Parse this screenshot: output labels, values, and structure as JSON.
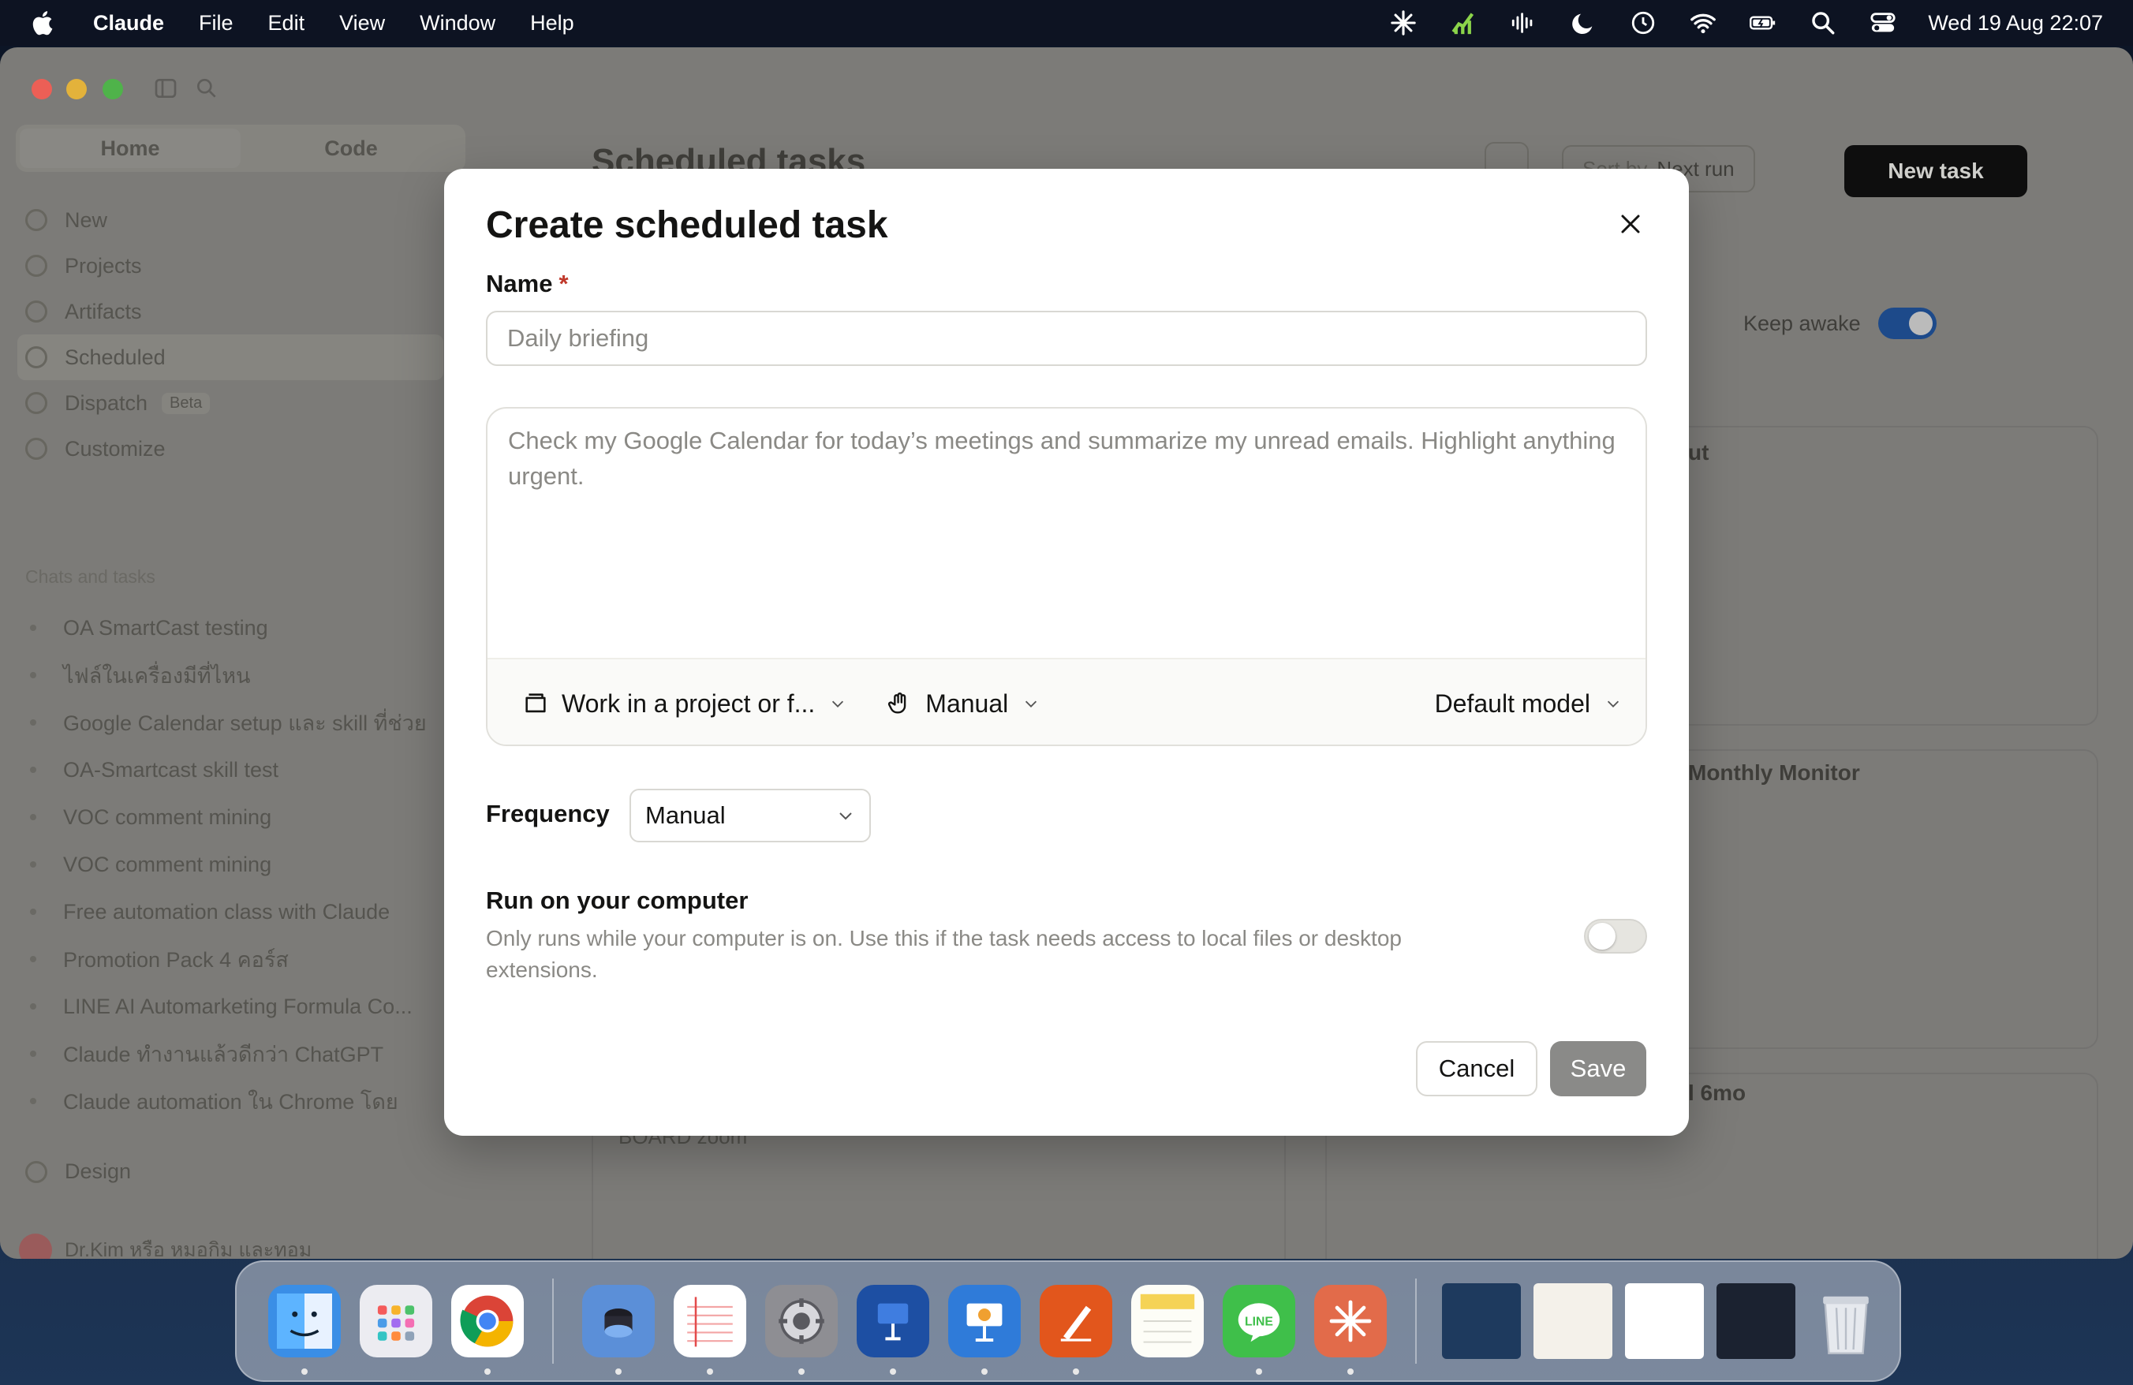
{
  "menubar": {
    "app_name": "Claude",
    "menus": [
      "File",
      "Edit",
      "View",
      "Window",
      "Help"
    ],
    "clock": "Wed 19 Aug  22:07",
    "status_icons": [
      "claude-icon",
      "stocks-icon",
      "audio-icon",
      "moon-icon",
      "timemachine-icon",
      "wifi-icon",
      "battery-icon",
      "search-icon",
      "control-center-icon"
    ]
  },
  "app": {
    "sidebar": {
      "modes": [
        "Home",
        "Code"
      ],
      "nav": [
        {
          "label": "New"
        },
        {
          "label": "Projects"
        },
        {
          "label": "Artifacts"
        },
        {
          "label": "Scheduled",
          "active": true
        },
        {
          "label": "Dispatch",
          "badge": "Beta"
        },
        {
          "label": "Customize"
        }
      ],
      "section_title": "Chats and tasks",
      "chats": [
        "OA SmartCast testing",
        "ไฟล์ในเครื่องมีที่ไหน",
        "Google Calendar setup และ skill ที่ช่วย",
        "OA-Smartcast skill test",
        "VOC comment mining",
        "VOC comment mining",
        "Free automation class with Claude",
        "Promotion Pack 4 คอร์ส",
        "LINE AI Automarketing Formula Co...",
        "Claude ทำงานแล้วดีกว่า ChatGPT",
        "Claude automation ใน Chrome โดย"
      ],
      "bottom_item": "Design",
      "user_name": "Dr.Kim หรือ หมอกิม และทอม"
    },
    "main": {
      "title": "Scheduled tasks",
      "sort_label": "Sort by",
      "sort_value": "Next run",
      "new_task": "New task",
      "keep_awake": "Keep awake",
      "cards": [
        "ut",
        "Monthly Monitor",
        "l 6mo"
      ],
      "card_sub": "BOARD zoom"
    }
  },
  "modal": {
    "title": "Create scheduled task",
    "name_label": "Name",
    "required_mark": "*",
    "name_placeholder": "Daily briefing",
    "name_value": "",
    "prompt_placeholder": "Check my Google Calendar for today’s meetings and summarize my unread emails. Highlight anything urgent.",
    "project_button": "Work in a project or f...",
    "permission_button": "Manual",
    "model_button": "Default model",
    "frequency_label": "Frequency",
    "frequency_value": "Manual",
    "run_title": "Run on your computer",
    "run_description": "Only runs while your computer is on. Use this if the task needs access to local files or desktop extensions.",
    "run_on_computer": false,
    "cancel_label": "Cancel",
    "save_label": "Save"
  },
  "dock": {
    "apps": [
      {
        "name": "finder",
        "color": "#3a8ee6"
      },
      {
        "name": "launchpad",
        "color": "#e9e9ee"
      },
      {
        "name": "chrome",
        "color": "#ffffff"
      },
      {
        "name": "dropzone",
        "color": "#5b8fd8"
      },
      {
        "name": "notebook",
        "color": "#ffffff"
      },
      {
        "name": "system-settings",
        "color": "#8e8e93"
      },
      {
        "name": "keynote-dark",
        "color": "#1d4fa3"
      },
      {
        "name": "keynote",
        "color": "#2f7bd9"
      },
      {
        "name": "pages",
        "color": "#e2561c"
      },
      {
        "name": "notes",
        "color": "#f5d356"
      },
      {
        "name": "line",
        "color": "#3fbf4a"
      },
      {
        "name": "claude",
        "color": "#e26b4a"
      }
    ]
  }
}
